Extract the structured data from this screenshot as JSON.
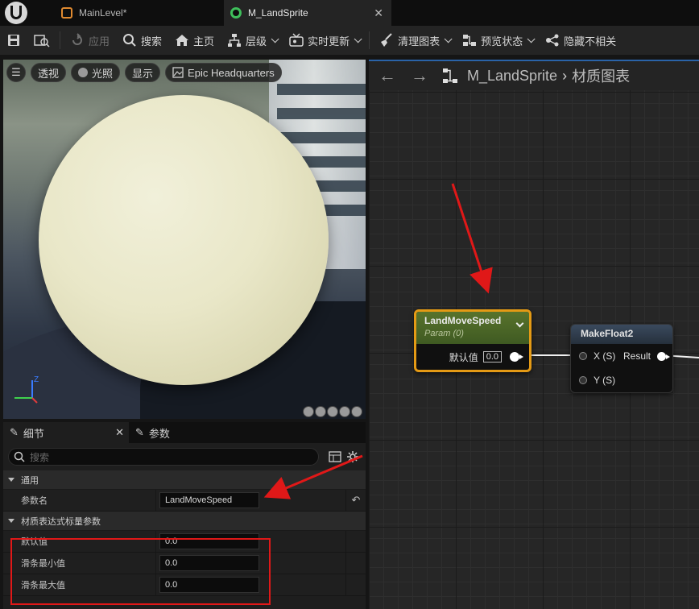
{
  "tabs": [
    {
      "label": "MainLevel*"
    },
    {
      "label": "M_LandSprite"
    }
  ],
  "toolbar": {
    "save": "save-icon",
    "browse": "browse-icon",
    "apply": "应用",
    "search": "搜索",
    "home": "主页",
    "hierarchy": "层级",
    "live_update": "实时更新",
    "clean_graph": "清理图表",
    "preview_state": "预览状态",
    "hide_unrelated": "隐藏不相关"
  },
  "viewport": {
    "menu": "☰",
    "perspective": "透视",
    "lit": "光照",
    "show": "显示",
    "environment": "Epic Headquarters"
  },
  "details": {
    "tab_details": "细节",
    "tab_params": "参数",
    "search_placeholder": "搜索",
    "category_general": "通用",
    "param_name_label": "参数名",
    "param_name_value": "LandMoveSpeed",
    "category_scalar": "材质表达式标量参数",
    "default_label": "默认值",
    "default_value": "0.0",
    "slider_min_label": "滑条最小值",
    "slider_min_value": "0.0",
    "slider_max_label": "滑条最大值",
    "slider_max_value": "0.0"
  },
  "graph": {
    "asset": "M_LandSprite",
    "section": "材质图表",
    "param_node": {
      "title": "LandMoveSpeed",
      "subtitle": "Param (0)",
      "default_label": "默认值",
      "default_value": "0.0"
    },
    "makefloat_node": {
      "title": "MakeFloat2",
      "x_pin": "X (S)",
      "y_pin": "Y (S)",
      "result": "Result"
    }
  },
  "colors": {
    "accent": "#e49a15",
    "annotation": "#e01818",
    "param_header": "#58732c"
  }
}
